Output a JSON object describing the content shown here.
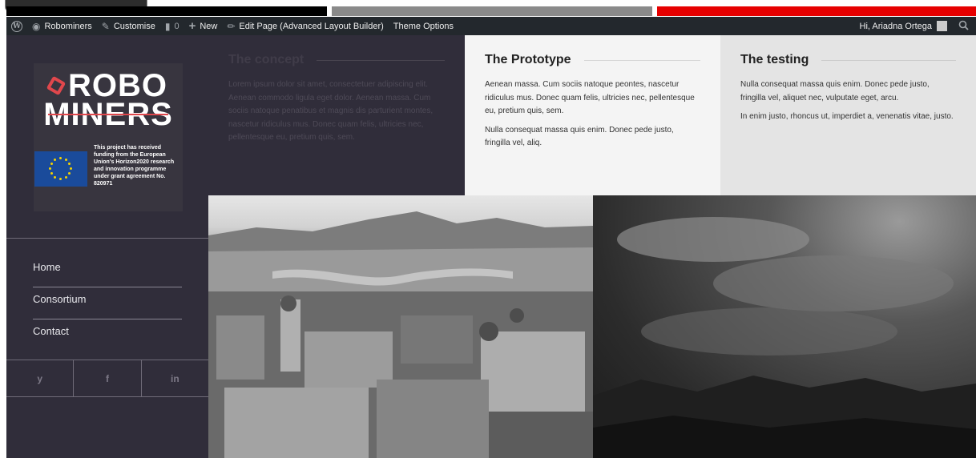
{
  "admin_bar": {
    "site_name": "Robominers",
    "customise": "Customise",
    "comments_count": "0",
    "new": "New",
    "edit_page": "Edit Page (Advanced Layout Builder)",
    "theme_options": "Theme Options",
    "greeting": "Hi, Ariadna Ortega",
    "icons": [
      "wordpress-icon",
      "dashboard-icon",
      "brush-icon",
      "comment-icon",
      "plus-icon",
      "pencil-icon",
      "avatar",
      "search-icon"
    ]
  },
  "sidebar": {
    "logo": {
      "line1": "ROBO",
      "line2": "MINERS",
      "eu_text": "This project has received funding from the European Union's Horizon2020 research and innovation programme under grant agreement No. 820971"
    },
    "nav": [
      {
        "label": "Home"
      },
      {
        "label": "Consortium"
      },
      {
        "label": "Contact"
      }
    ],
    "social": [
      {
        "label": "y",
        "icon": "twitter-icon"
      },
      {
        "label": "f",
        "icon": "facebook-icon"
      },
      {
        "label": "in",
        "icon": "linkedin-icon"
      }
    ]
  },
  "columns": [
    {
      "title": "The concept",
      "paragraphs": [
        "Lorem ipsum dolor sit amet, consectetuer adipiscing elit. Aenean commodo ligula eget dolor. Aenean massa. Cum sociis natoque penatibus et magnis dis parturient montes, nascetur ridiculus mus. Donec quam felis, ultricies nec, pellentesque eu, pretium quis, sem."
      ]
    },
    {
      "title": "The Prototype",
      "paragraphs": [
        "Aenean massa. Cum sociis natoque peontes, nascetur ridiculus mus. Donec quam felis, ultricies nec, pellentesque eu, pretium quis, sem.",
        "Nulla consequat massa quis enim. Donec pede justo, fringilla vel, aliq."
      ]
    },
    {
      "title": "The testing",
      "paragraphs": [
        "Nulla consequat massa quis enim. Donec pede justo, fringilla vel, aliquet nec, vulputate eget, arcu.",
        "In enim justo, rhoncus ut, imperdiet a, venenatis vitae, justo."
      ]
    }
  ],
  "colors": {
    "admin_bar": "#23282d",
    "sidebar": "#302d3a",
    "logo_accent": "#e0474c",
    "eu_blue": "#1a4b9b",
    "eu_star": "#f5d300",
    "strip_red": "#e60000"
  }
}
